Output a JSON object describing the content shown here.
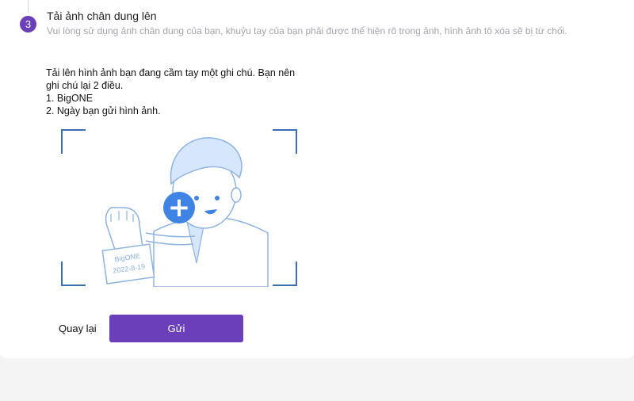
{
  "step": {
    "number": "3",
    "title": "Tải ảnh chân dung lên",
    "description": "Vui lòng sử dụng ảnh chân dung của bạn, khuỷu tay của bạn phải được thể hiện rõ trong ảnh, hình ảnh tô xóa sẽ bị từ chối."
  },
  "instructions": {
    "line1": "Tải lên hình ảnh bạn đang cầm tay một ghi chú. Bạn nên",
    "line2": "ghi chú lại 2 điều.",
    "line3": "1. BigONE",
    "line4": "2. Ngày bạn gửi hình ảnh."
  },
  "illustration": {
    "note_line1": "BigONE",
    "note_line2": "2022-8-19",
    "icon": "plus-icon"
  },
  "actions": {
    "back_label": "Quay lại",
    "submit_label": "Gửi"
  },
  "colors": {
    "accent": "#6a3fb9",
    "upload_plus": "#3f84e5",
    "frame": "#3b6fb3",
    "illustration_fill": "#d6e6fb",
    "illustration_stroke": "#8db3e3"
  }
}
